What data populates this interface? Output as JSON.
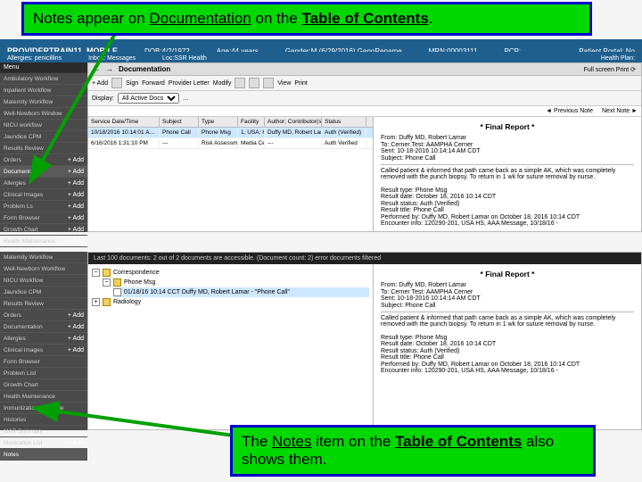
{
  "callouts": {
    "top_pre": "Notes appear on ",
    "top_u": "Documentation",
    "top_mid": " on the ",
    "top_b": "Table of Contents",
    "top_suf": ".",
    "bottom_pre": "The ",
    "bottom_u": "Notes",
    "bottom_mid": "  item on the ",
    "bottom_b": "Table of Contents",
    "bottom_suf": " also shows them."
  },
  "patient_bar": {
    "name": "PROVIDERTRAIN11, MOBILE",
    "dob": "DOB:4/2/1972",
    "age": "Age:44 years",
    "gender": "Gender:M (6/29/2016) GenoRename",
    "mrn": "MRN:00003111",
    "pcp": "PCP:",
    "pt_portal": "Patient Portal: No",
    "allergies": "Allergies: penicillins",
    "inbox": "Inbox: Messages",
    "locssn": "Loc:SSR Health",
    "healthplan": "Health Plan:"
  },
  "sidebar1": {
    "menu": "Menu",
    "items": [
      "Ambulatory Workflow",
      "Inpatient Workflow",
      "Maternity Workflow",
      "Well-Newborn Window",
      "NICU workflow",
      "Jaundice CPM",
      "Results Review",
      "Orders",
      "Documentation",
      "Allergies",
      "Clinical Images",
      "Problem Ls",
      "Form Browser",
      "Growth Chart",
      "Health Maintenance"
    ],
    "selected_index": 8,
    "add_label": "+ Add",
    "all_label": "All"
  },
  "sidebar2": {
    "items": [
      "Maternity Workflow",
      "Well-Newborn Workflow",
      "NICU Workflow",
      "Jaundice CPM",
      "Results Review",
      "Orders",
      "Documentation",
      "Allergies",
      "Clinical Images",
      "Form Browser",
      "Problem List",
      "Growth Chart",
      "Health Maintenance",
      "Immunization Schedule",
      "Histories",
      "MAR Summary",
      "Medication List",
      "Notes"
    ],
    "selected_index": 17
  },
  "doc_header": {
    "back": "←",
    "fwd": "→",
    "title": "Documentation",
    "actions": "Full screen  Print  ⟳"
  },
  "toolbar": {
    "add": "+ Add",
    "sign": "Sign",
    "forward": "Forward",
    "provider_letter": "Provider Letter",
    "modify": "Modify",
    "more": "…",
    "view": "View",
    "print": "Print"
  },
  "display": {
    "label": "Display:",
    "option": "All Active Docs",
    "btn": "…"
  },
  "meta": {
    "prev": "◄ Previous Note",
    "next": "Next Note ►"
  },
  "doc_table": {
    "headers": [
      "Service Date/Time",
      "Subject",
      "Type",
      "Facility",
      "Author; Contributor(s)",
      "Status"
    ],
    "row": {
      "date": "10/18/2016 10:14:01 A…",
      "subject": "Phone Call",
      "type": "Phone Msg",
      "facility": "1, USA: HS",
      "author": "Duffy MD, Robert Lamar",
      "status": "Auth (Verified)"
    },
    "row2": {
      "date": "6/16/2016 1:31:10 PM",
      "subject": "---",
      "type": "Risk Assessme",
      "facility": "Media Center",
      "author": "---",
      "status": "Auth Verified"
    }
  },
  "report": {
    "title": "* Final Report *",
    "from": "From: Duffy MD, Robert Lamar",
    "to": "To: Cerner Test: AAMPHA Cerner",
    "sent": "Sent: 10-18-2016 10:14:14 AM CDT",
    "subject": "Subject: Phone Call",
    "body": "Called patient & informed that path came back as a simple AK, which was completely removed with the punch biopsy. To return in 1 wk for suture removal by nurse.",
    "l1k": "Result type:",
    "l1v": "Phone Msg",
    "l2k": "Result date:",
    "l2v": "October 18, 2016 10:14 CDT",
    "l3k": "Result status:",
    "l3v": "Auth (Verified)",
    "l4k": "Result title:",
    "l4v": "Phone Call",
    "l5k": "Performed by:",
    "l5v": "Duffy MD, Robert Lamar on October 18, 2016 10:14 CDT",
    "l6k": "Encounter info:",
    "l6v": "120290-201, USA HS, AAA Message, 10/18/16 -"
  },
  "black_bar": "Last 100 documents: 2 out of 2 documents are accessible. (Document count: 2) error documents filtered",
  "tree": {
    "root": "Correspondence",
    "phone": "Phone Msg",
    "doc_item": "01/18/16 10:14 CCT Duffy MD, Robert Lamar - \"Phone Call\"",
    "radiology": "Radiology"
  }
}
